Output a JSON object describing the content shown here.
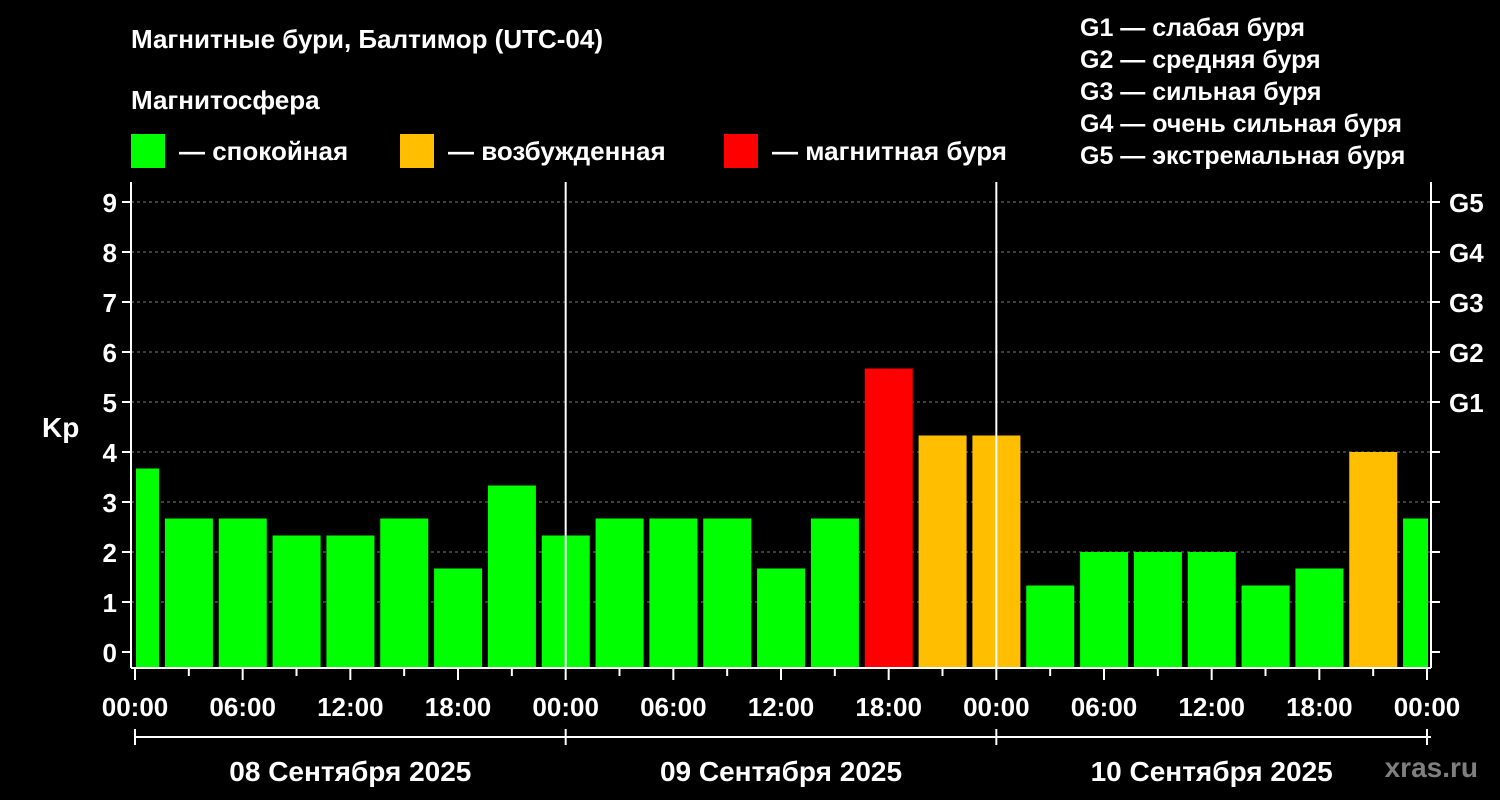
{
  "title": "Магнитные бури, Балтимор (UTC-04)",
  "magnetosphere": {
    "title": "Магнитосфера",
    "legend": [
      {
        "label": "— спокойная",
        "color": "#00ff00"
      },
      {
        "label": "— возбужденная",
        "color": "#ffbf00"
      },
      {
        "label": "— магнитная буря",
        "color": "#ff0000"
      }
    ]
  },
  "storm_levels": [
    "G1 — слабая буря",
    "G2 — средняя буря",
    "G3 — сильная буря",
    "G4 — очень сильная буря",
    "G5 — экстремальная буря"
  ],
  "watermark": "xras.ru",
  "chart_data": {
    "type": "bar",
    "ylabel": "Kp",
    "ylim": [
      0,
      9
    ],
    "yticks": [
      0,
      1,
      2,
      3,
      4,
      5,
      6,
      7,
      8,
      9
    ],
    "right_ticks": [
      {
        "value": 5,
        "label": "G1"
      },
      {
        "value": 6,
        "label": "G2"
      },
      {
        "value": 7,
        "label": "G3"
      },
      {
        "value": 8,
        "label": "G4"
      },
      {
        "value": 9,
        "label": "G5"
      }
    ],
    "grid": true,
    "xtick_labels": [
      "00:00",
      "06:00",
      "12:00",
      "18:00",
      "00:00",
      "06:00",
      "12:00",
      "18:00",
      "00:00",
      "06:00",
      "12:00",
      "18:00",
      "00:00"
    ],
    "days": [
      "08 Сентября 2025",
      "09 Сентября 2025",
      "10 Сентября 2025"
    ],
    "thresholds": {
      "excited": 4,
      "storm": 5
    },
    "colors": {
      "quiet": "#00ff00",
      "excited": "#ffbf00",
      "storm": "#ff0000"
    },
    "series": [
      {
        "values": [
          3.67,
          2.67,
          2.67,
          2.33,
          2.33,
          2.67,
          1.67,
          3.33,
          2.33,
          2.67,
          2.67,
          2.67,
          1.67,
          2.67,
          5.67,
          4.33,
          4.33,
          1.33,
          2.0,
          2.0,
          2.0,
          1.33,
          1.67,
          4.0,
          2.67
        ]
      }
    ]
  }
}
